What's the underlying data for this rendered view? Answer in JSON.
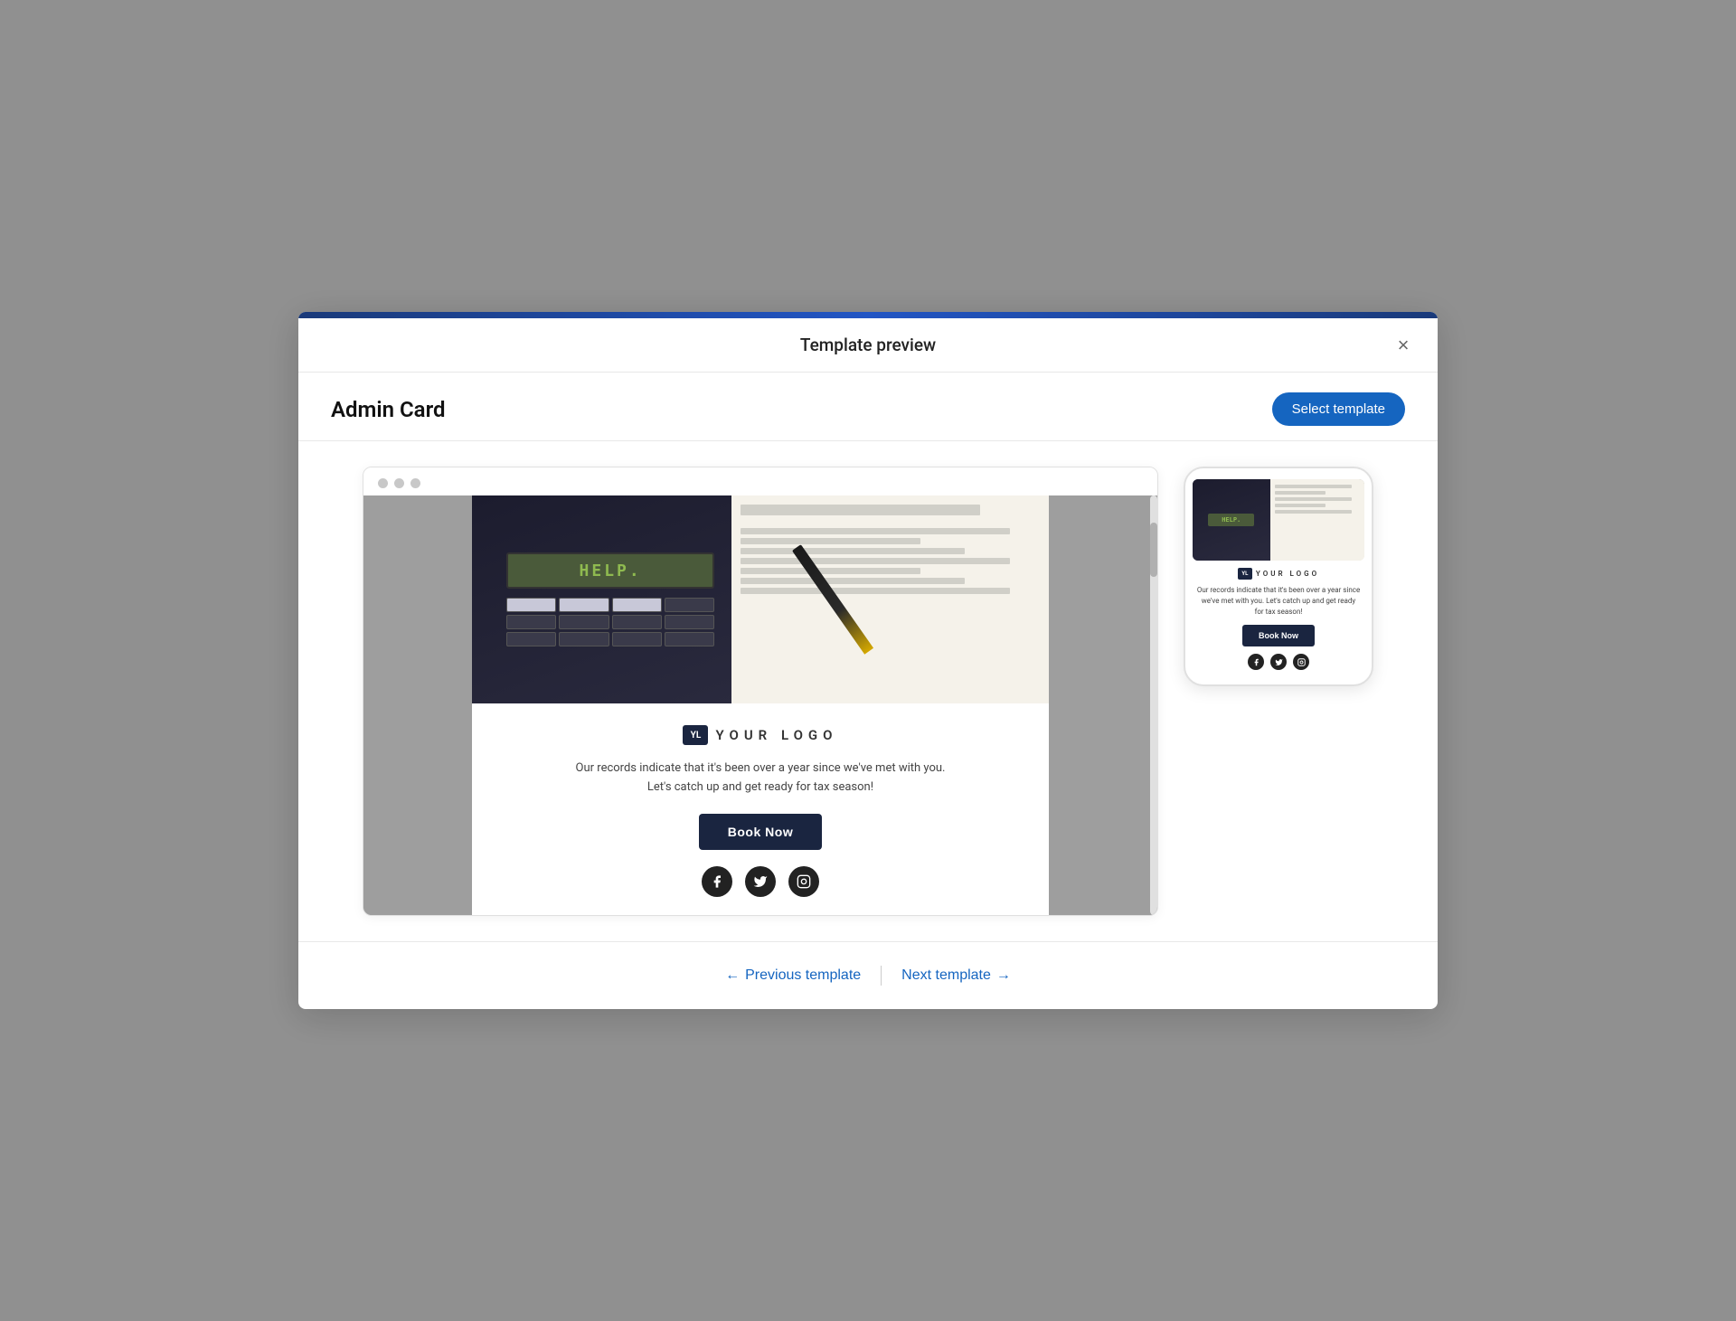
{
  "modal": {
    "title": "Template preview",
    "template_name": "Admin Card",
    "select_button_label": "Select template",
    "close_label": "×"
  },
  "email_template": {
    "logo_initials": "YL",
    "logo_text": "YOUR LOGO",
    "description_line1": "Our records indicate that it's been over a year since we've met with you.",
    "description_line2": "Let's catch up and get ready for tax season!",
    "book_button_label": "Book Now",
    "calc_display": "HELP."
  },
  "navigation": {
    "previous_label": "Previous template",
    "next_label": "Next template",
    "prev_arrow": "←",
    "next_arrow": "→"
  },
  "browser": {
    "dot1": "",
    "dot2": "",
    "dot3": ""
  }
}
